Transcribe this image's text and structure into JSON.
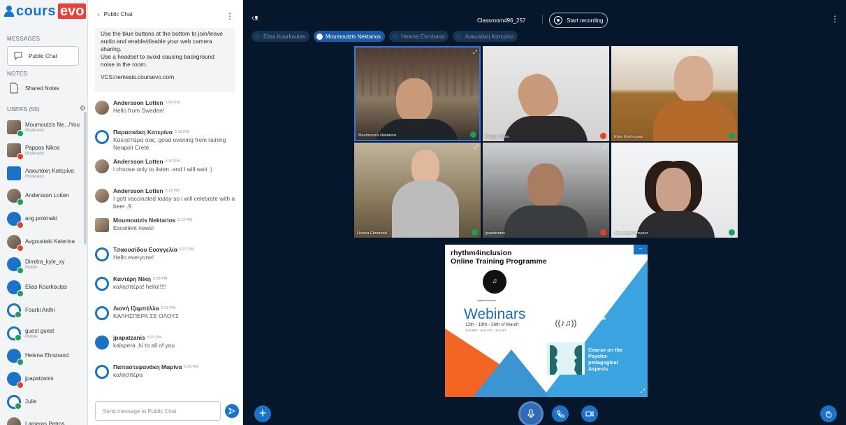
{
  "brand": {
    "part1": "cours",
    "part2": "evo"
  },
  "nav": {
    "messages_header": "MESSAGES",
    "public_chat": "Public Chat",
    "notes_header": "NOTES",
    "shared_notes": "Shared Notes",
    "users_header": "USERS (50)",
    "users": [
      {
        "name": "Moumoutzis Ne.../You",
        "role": "Moderator",
        "status": "green",
        "avatar": "photo-square"
      },
      {
        "name": "Pappas Nikos",
        "role": "Moderator",
        "status": "red",
        "avatar": "photo-square"
      },
      {
        "name": "Λακωτάκη Κατερίνα",
        "role": "Moderator",
        "status": "",
        "avatar": "blue-square"
      },
      {
        "name": "Andersson Lotten",
        "role": "",
        "status": "green",
        "avatar": "photo"
      },
      {
        "name": "ang.proimaki",
        "role": "",
        "status": "red",
        "avatar": "blue"
      },
      {
        "name": "Avgoustaki Katerina",
        "role": "",
        "status": "red",
        "avatar": "photo"
      },
      {
        "name": "Dimitra_kyle_xy",
        "role": "Mobile",
        "status": "green",
        "avatar": "blue"
      },
      {
        "name": "Elias Kourkoutas",
        "role": "",
        "status": "green",
        "avatar": "blue"
      },
      {
        "name": "Fourki Anthi",
        "role": "",
        "status": "green",
        "avatar": "ring"
      },
      {
        "name": "guest guest",
        "role": "Mobile",
        "status": "green",
        "avatar": "ring"
      },
      {
        "name": "Helena Ehrstrand",
        "role": "",
        "status": "green",
        "avatar": "blue"
      },
      {
        "name": "jpapatzanis",
        "role": "",
        "status": "red",
        "avatar": "blue"
      },
      {
        "name": "Julie",
        "role": "",
        "status": "green",
        "avatar": "ring"
      },
      {
        "name": "Lameras Petros",
        "role": "",
        "status": "",
        "avatar": "photo"
      }
    ]
  },
  "chat": {
    "header_title": "Public Chat",
    "notice_lines": [
      "Use the blue buttons at the bottom to join/leave audio and enable/disable your web camera sharing.",
      "Use a headset to avoid causing background noise in the room."
    ],
    "vcs": "VCS:nemesis.coursevo.com",
    "messages": [
      {
        "name": "Andersson Lotten",
        "time": "5:09 PM",
        "text": "Hello from Sweden!",
        "avatar": "photo"
      },
      {
        "name": "Παρασκάκη Κατερίνα",
        "time": "5:10 PM",
        "text": "Καλησπέρα σας, good evening from raining Neapoli Crete",
        "avatar": "ring"
      },
      {
        "name": "Andersson Lotten",
        "time": "5:10 PM",
        "text": "i choose only to listen. and I will wait :)",
        "avatar": "photo"
      },
      {
        "name": "Andersson Lotten",
        "time": "5:11 PM",
        "text": "I gott vaccinated today so i will celebrate with a beer .9",
        "avatar": "photo"
      },
      {
        "name": "Moumoutzis Nektarios",
        "time": "5:12 PM",
        "text": "Excellent news!",
        "avatar": "photo-square"
      },
      {
        "name": "Τσαουσίδου Ευαγγελία",
        "time": "5:27 PM",
        "text": "Hello everyone!",
        "avatar": "ring"
      },
      {
        "name": "Καντέρη Νίκη",
        "time": "5:28 PM",
        "text": "καλησπέρα! hello!!!!!",
        "avatar": "ring"
      },
      {
        "name": "Λιονή Ιζαμπέλλα",
        "time": "5:28 PM",
        "text": "ΚΑΛΗΣΠΕΡΑ ΣΕ ΟΛΟΥΣ",
        "avatar": "ring"
      },
      {
        "name": "jpapatzanis",
        "time": "5:29 PM",
        "text": "kalspera ,hi to all of you",
        "avatar": "blue"
      },
      {
        "name": "Παπαστεφανάκη Μαρίνα",
        "time": "5:29 PM",
        "text": "καλησπέρα",
        "avatar": "ring"
      }
    ],
    "compose_placeholder": "Send message to Public Chat"
  },
  "main": {
    "room": "Classroom496_257",
    "record_label": "Start recording",
    "talkers": [
      {
        "name": "Elias Kourkoutas",
        "active": false
      },
      {
        "name": "Moumoutzis Nektarios",
        "active": true
      },
      {
        "name": "Helena Ehrstrand",
        "active": false
      },
      {
        "name": "Λακωτάκη Κατερίνα",
        "active": false
      }
    ],
    "tiles": [
      {
        "label": "Moumoutzis Nektarios",
        "mic": "green"
      },
      {
        "label": "Pappas Nikos",
        "mic": "red"
      },
      {
        "label": "Elias Kourkoutas",
        "mic": "green"
      },
      {
        "label": "Helena Ehrstrand",
        "mic": "green"
      },
      {
        "label": "jpapatzanis",
        "mic": "red"
      },
      {
        "label": "Λακωτάκη Κατερίνα",
        "mic": "green"
      }
    ],
    "presentation": {
      "title_line1": "rhythm4inclusion",
      "title_line2": "Online Training Programme",
      "brand_small": "rhythm4inclusion",
      "webinars": "Webinars",
      "dates": "12th - 19th - 26th of March",
      "dates_small": "15:00 WET · 16:00 CET · 17:00 EET",
      "music_line1": "Music",
      "music_line2": "Course",
      "course_line1": "Course on the",
      "course_line2": "Psycho-",
      "course_line3": "pedagogical",
      "course_line4": "Aspects",
      "minimize": "–"
    }
  },
  "colors": {
    "accent": "#1a73c7",
    "brand_red": "#ef3e36",
    "main_bg": "#06172c",
    "status_green": "#1b9e5b",
    "status_red": "#e0412b"
  }
}
